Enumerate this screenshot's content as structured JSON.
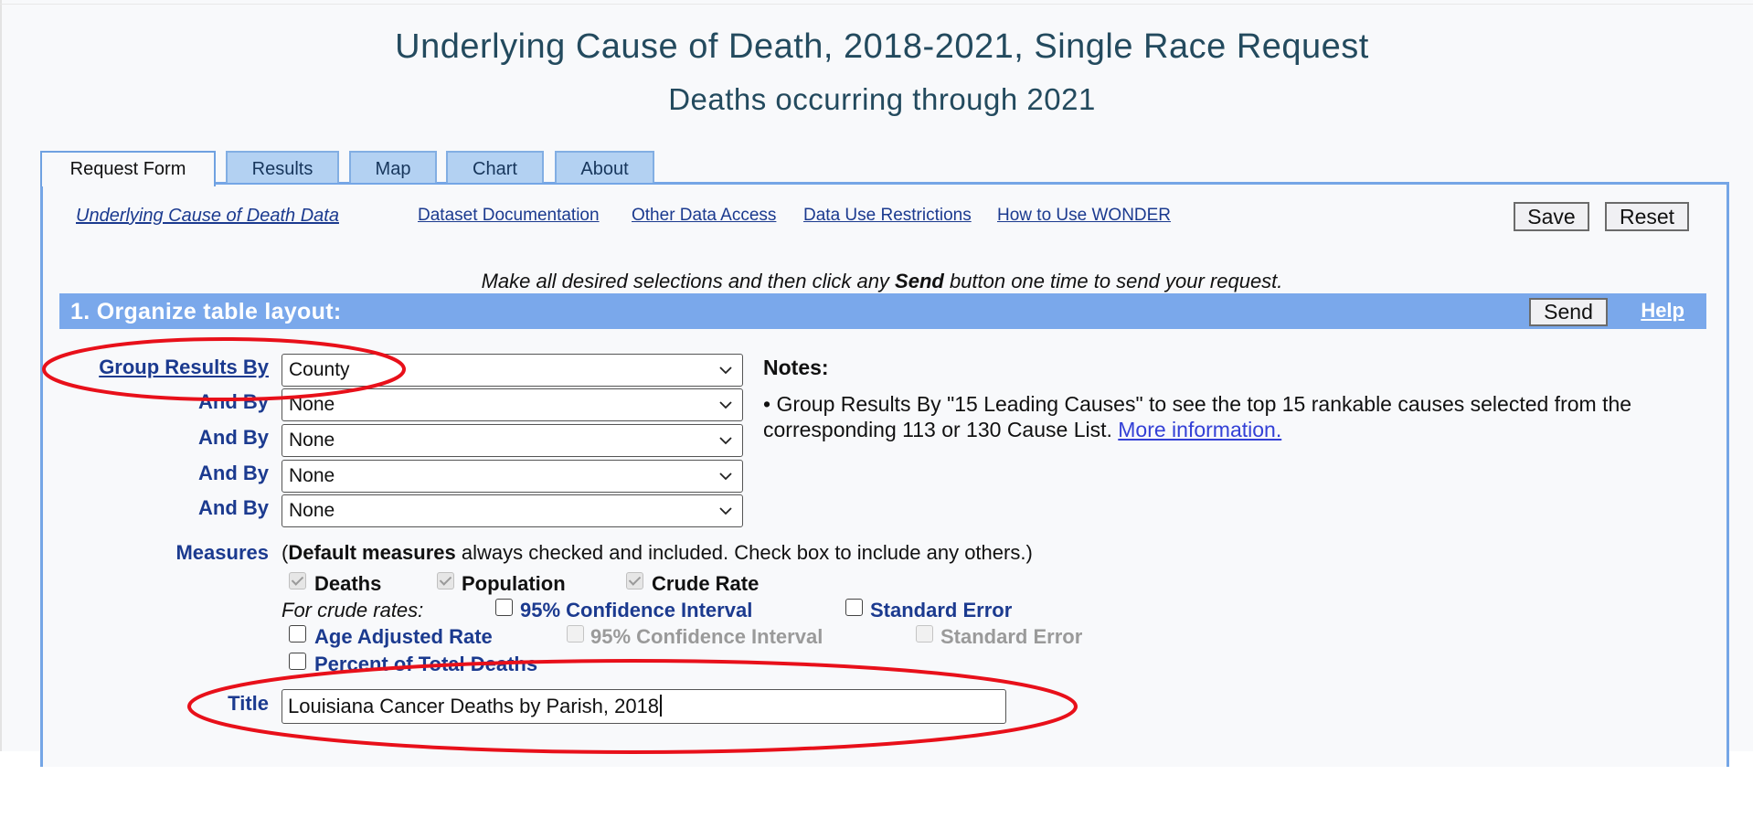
{
  "header": {
    "title": "Underlying Cause of Death, 2018-2021, Single Race Request",
    "subtitle": "Deaths occurring through 2021"
  },
  "tabs": [
    {
      "label": "Request Form",
      "active": true
    },
    {
      "label": "Results",
      "active": false
    },
    {
      "label": "Map",
      "active": false
    },
    {
      "label": "Chart",
      "active": false
    },
    {
      "label": "About",
      "active": false
    }
  ],
  "links": {
    "dataset": "Underlying Cause of Death Data",
    "documentation": "Dataset Documentation",
    "other_access": "Other Data Access",
    "restrictions": "Data Use Restrictions",
    "how_to": "How to Use WONDER"
  },
  "buttons": {
    "save": "Save",
    "reset": "Reset",
    "send": "Send",
    "help": "Help"
  },
  "instruction": {
    "before": "Make all desired selections and then click any ",
    "bold": "Send",
    "after": " button one time to send your request."
  },
  "section1": {
    "title": "1. Organize table layout:",
    "group_by_label": "Group Results By",
    "and_by_label": "And By",
    "group_by_rows": [
      {
        "value": "County"
      },
      {
        "value": "None"
      },
      {
        "value": "None"
      },
      {
        "value": "None"
      },
      {
        "value": "None"
      }
    ],
    "notes_title": "Notes:",
    "notes_text": "• Group Results By \"15 Leading Causes\" to see the top 15 rankable causes selected from the corresponding 113 or 130 Cause List.",
    "notes_link": "More information.",
    "measures_label": "Measures",
    "measures_desc_open": "(",
    "measures_desc_bold": "Default measures",
    "measures_desc_rest": " always checked and included. Check box to include any others.)",
    "default_measures": [
      "Deaths",
      "Population",
      "Crude Rate"
    ],
    "crude_rates_label": "For crude rates:",
    "crude_options": [
      "95% Confidence Interval",
      "Standard Error"
    ],
    "age_adjusted": "Age Adjusted Rate",
    "age_adjusted_options": [
      "95% Confidence Interval",
      "Standard Error"
    ],
    "percent_total": "Percent of Total Deaths",
    "title_label": "Title",
    "title_value": "Louisiana Cancer Deaths by Parish, 2018"
  },
  "colors": {
    "accent_bar": "#7aa8eb",
    "tab_bg": "#b3d1f2",
    "label_blue": "#1b3a8f",
    "annotation_red": "#e8101a"
  }
}
